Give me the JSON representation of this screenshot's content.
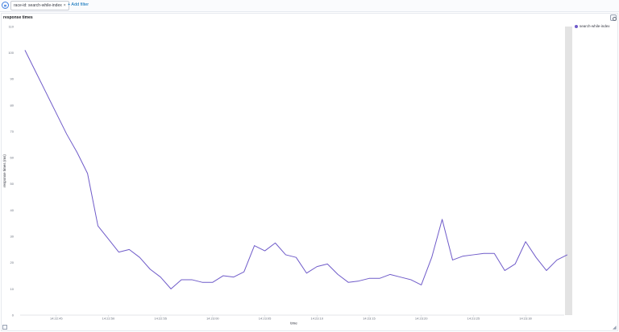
{
  "filter_bar": {
    "filter_label": "race-id: search-while-index",
    "close_glyph": "×",
    "add_filter_label": "+ Add filter",
    "toggle_icon": "filter-options-icon"
  },
  "panel": {
    "title": "response times",
    "settings_icon": "gear-icon"
  },
  "legend": {
    "items": [
      {
        "label": "search-while-index",
        "color": "#6f5bc9"
      }
    ]
  },
  "chart_data": {
    "type": "line",
    "title": "response times",
    "xlabel": "time",
    "ylabel": "response times (ms)",
    "ylim": [
      0,
      110
    ],
    "yticks": [
      0,
      10,
      20,
      30,
      40,
      50,
      60,
      70,
      80,
      90,
      100,
      110
    ],
    "xticks": [
      {
        "label": "14:22:45",
        "t": 3
      },
      {
        "label": "14:22:50",
        "t": 8
      },
      {
        "label": "14:22:55",
        "t": 13
      },
      {
        "label": "14:23:00",
        "t": 18
      },
      {
        "label": "14:23:05",
        "t": 23
      },
      {
        "label": "14:23:10",
        "t": 28
      },
      {
        "label": "14:23:15",
        "t": 33
      },
      {
        "label": "14:23:20",
        "t": 38
      },
      {
        "label": "14:23:25",
        "t": 43
      },
      {
        "label": "14:23:30",
        "t": 48
      }
    ],
    "xlim": [
      -0.15,
      51.7
    ],
    "grid": false,
    "legend_position": "top-right",
    "series": [
      {
        "name": "search-while-index",
        "color": "#6f5bc9",
        "x": [
          0,
          1,
          2,
          3,
          4,
          5,
          6,
          7,
          8,
          9,
          10,
          11,
          12,
          13,
          14,
          15,
          16,
          17,
          18,
          19,
          20,
          21,
          22,
          23,
          24,
          25,
          26,
          27,
          28,
          29,
          30,
          31,
          32,
          33,
          34,
          35,
          36,
          37,
          38,
          39,
          40,
          41,
          42,
          43,
          44,
          45,
          46,
          47,
          48,
          49,
          50,
          51,
          52
        ],
        "values": [
          101,
          93,
          85,
          77,
          69,
          62,
          54,
          34,
          29,
          24,
          25,
          22,
          17.5,
          14.5,
          10,
          13.5,
          13.5,
          12.5,
          12.5,
          15,
          14.5,
          16.5,
          26.5,
          24.5,
          27.5,
          23,
          22,
          16,
          18.5,
          19.5,
          15.5,
          12.5,
          13,
          14,
          14,
          15.5,
          14.5,
          13.5,
          11.5,
          22,
          36.5,
          21,
          22.5,
          23,
          23.5,
          23.5,
          17,
          19.5,
          28,
          22,
          17,
          21,
          23
        ]
      }
    ]
  },
  "footer": {
    "toggle_icon": "data-table-toggle-icon",
    "resize_glyph": "◢"
  }
}
